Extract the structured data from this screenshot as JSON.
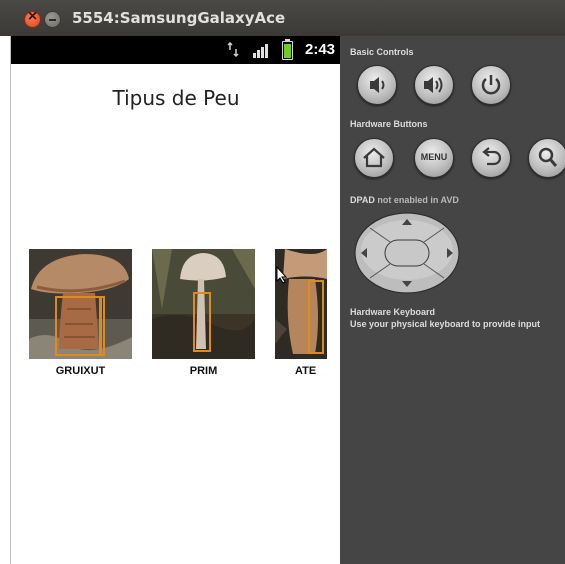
{
  "window": {
    "title": "5554:SamsungGalaxyAce"
  },
  "status_bar": {
    "time": "2:43",
    "icons": [
      "data-transfer-icon",
      "signal-icon",
      "battery-icon"
    ]
  },
  "screen": {
    "title": "Tipus de Peu",
    "options": [
      {
        "label": "GRUIXUT"
      },
      {
        "label": "PRIM"
      },
      {
        "label": "ATE"
      }
    ]
  },
  "controls": {
    "basic_controls_label": "Basic Controls",
    "basic_buttons": [
      "volume-down-icon",
      "volume-up-icon",
      "power-icon"
    ],
    "hardware_buttons_label": "Hardware Buttons",
    "hardware_buttons": [
      "home-icon",
      "menu-button",
      "back-icon",
      "search-icon"
    ],
    "menu_label": "MENU",
    "dpad_label": "DPAD",
    "dpad_note": " not enabled in AVD",
    "keyboard_label": "Hardware Keyboard",
    "keyboard_note": "Use your physical keyboard to provide input"
  },
  "colors": {
    "panel_bg": "#454545",
    "status_bar": "#000000",
    "outline_box": "#e08a1a"
  }
}
